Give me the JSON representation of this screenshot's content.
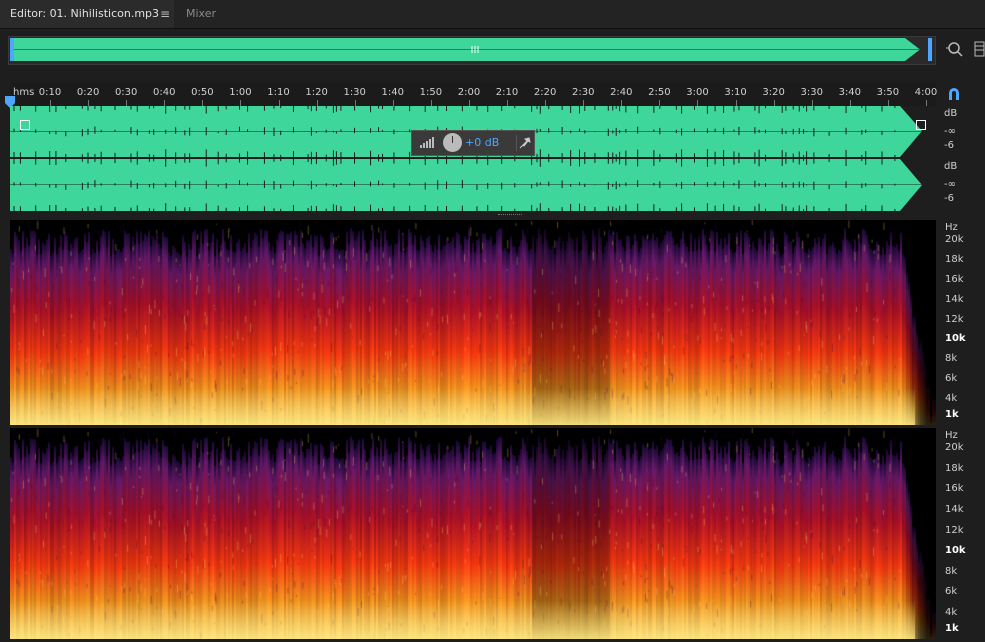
{
  "tabs": {
    "editor_label": "Editor: 01. Nihilisticon.mp3",
    "editor_menu_icon": "≡",
    "mixer_label": "Mixer"
  },
  "ruler": {
    "unit": "hms",
    "ticks": [
      "0:10",
      "0:20",
      "0:30",
      "0:40",
      "0:50",
      "1:00",
      "1:10",
      "1:20",
      "1:30",
      "1:40",
      "1:50",
      "2:00",
      "2:10",
      "2:20",
      "2:30",
      "2:40",
      "2:50",
      "3:00",
      "3:10",
      "3:20",
      "3:30",
      "3:40",
      "3:50",
      "4:00"
    ]
  },
  "hud": {
    "volume_value": "+0 dB"
  },
  "amplitude_scale": {
    "top_unit": "dB",
    "top_ticks": [
      "-∞",
      "-6"
    ],
    "bottom_unit": "dB",
    "bottom_ticks": [
      "-∞",
      "-6"
    ]
  },
  "frequency_scale": {
    "unit": "Hz",
    "labels": [
      "20k",
      "18k",
      "16k",
      "14k",
      "12k",
      "10k",
      "8k",
      "6k",
      "4k",
      "1k"
    ]
  },
  "colors": {
    "waveform": "#3ed69a",
    "accent": "#4da6ff",
    "spectral_hot": "#ffe680",
    "spectral_mid": "#ff5a1a",
    "spectral_cool": "#6a1a6e"
  }
}
